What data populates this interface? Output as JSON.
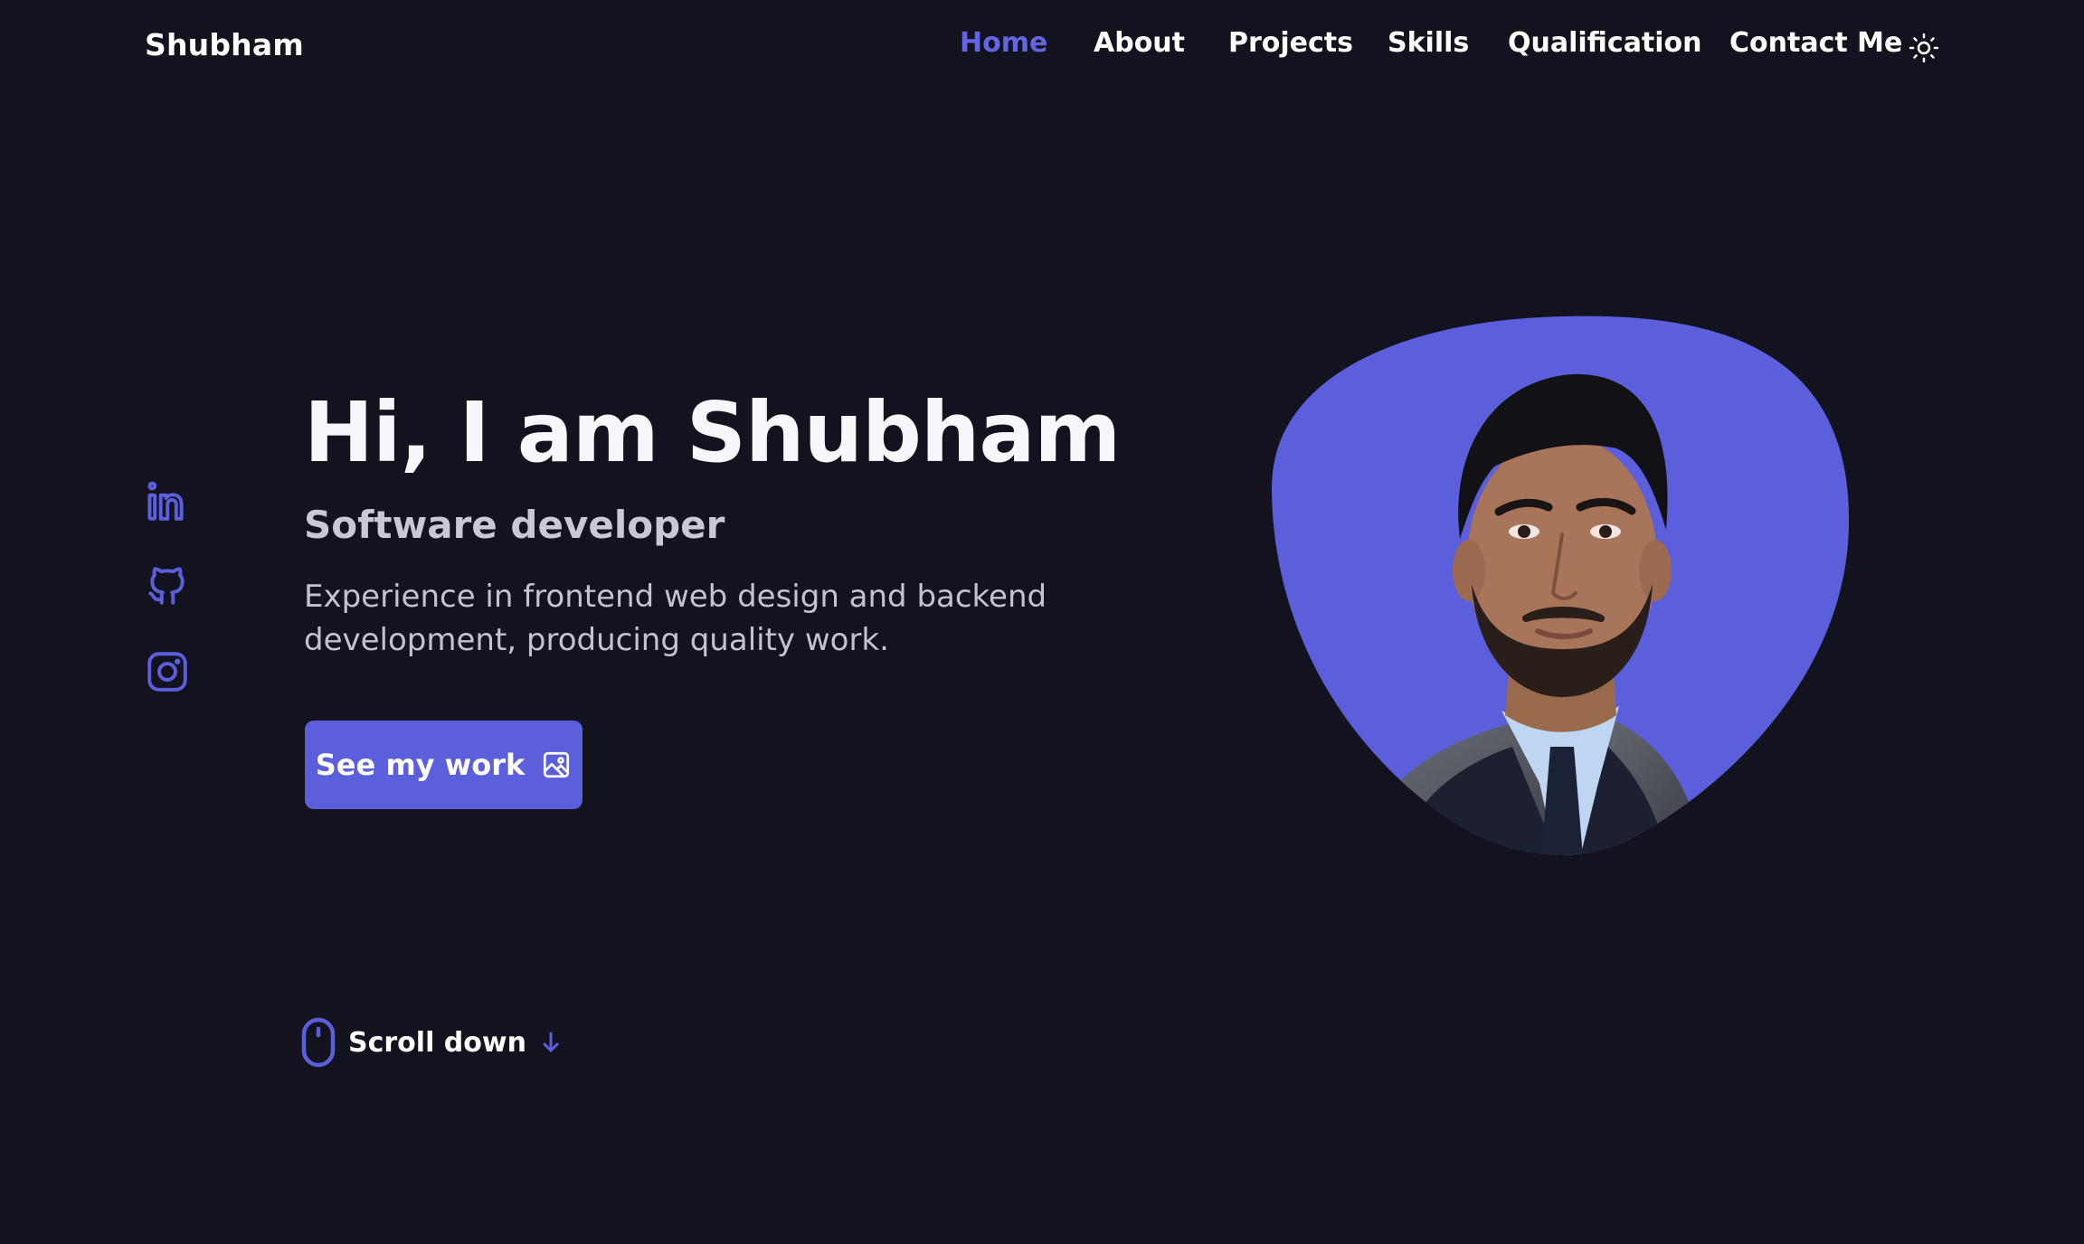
{
  "brand": {
    "name": "Shubham",
    "accent_color": "#5b5fdc",
    "background_color": "#13131f"
  },
  "nav": {
    "items": [
      {
        "label": "Home",
        "active": true
      },
      {
        "label": "About",
        "active": false
      },
      {
        "label": "Projects",
        "active": false
      },
      {
        "label": "Skills",
        "active": false
      },
      {
        "label": "Qualification",
        "active": false
      },
      {
        "label": "Contact Me",
        "active": false
      }
    ],
    "theme_toggle_icon": "sun-icon"
  },
  "social": [
    {
      "icon": "linkedin-icon"
    },
    {
      "icon": "github-icon"
    },
    {
      "icon": "instagram-icon"
    }
  ],
  "hero": {
    "title": "Hi, I am Shubham",
    "subtitle": "Software developer",
    "description": "Experience in frontend web design and backend development, producing quality work.",
    "cta_label": "See my work",
    "cta_icon": "image-icon",
    "portrait_icon": "profile-photo"
  },
  "scroll": {
    "label": "Scroll down",
    "mouse_icon": "mouse-icon",
    "arrow_icon": "arrow-down-icon"
  }
}
